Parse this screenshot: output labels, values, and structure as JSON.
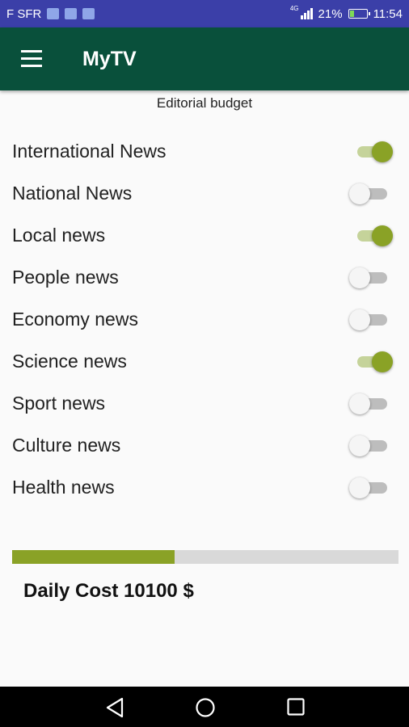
{
  "status_bar": {
    "carrier": "F SFR",
    "network": "4G",
    "battery": "21%",
    "time": "11:54"
  },
  "app_bar": {
    "title": "MyTV",
    "menu_icon": "hamburger-menu-icon"
  },
  "subtitle": "Editorial budget",
  "toggles": [
    {
      "label": "International News",
      "on": true
    },
    {
      "label": "National News",
      "on": false
    },
    {
      "label": "Local news",
      "on": true
    },
    {
      "label": "People news",
      "on": false
    },
    {
      "label": "Economy news",
      "on": false
    },
    {
      "label": "Science news",
      "on": true
    },
    {
      "label": "Sport news",
      "on": false
    },
    {
      "label": "Culture news",
      "on": false
    },
    {
      "label": "Health news",
      "on": false
    }
  ],
  "budget_progress": 0.42,
  "daily_cost": "Daily Cost 10100 $",
  "colors": {
    "status_bar": "#3b3fa8",
    "app_bar": "#09503b",
    "accent": "#8aa226"
  },
  "nav_icons": [
    "back-icon",
    "home-icon",
    "recent-apps-icon"
  ]
}
